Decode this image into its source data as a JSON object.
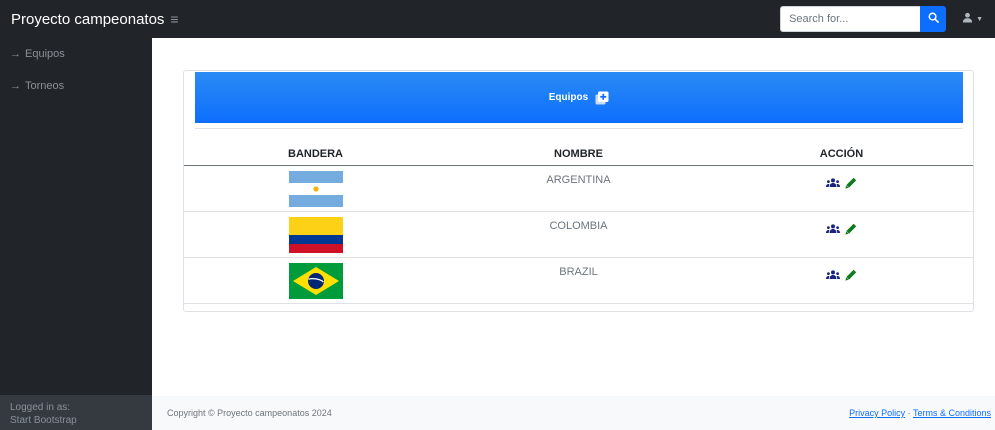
{
  "header": {
    "brand": "Proyecto campeonatos",
    "toggle_icon": "menu-icon",
    "search_placeholder": "Search for...",
    "search_icon": "search-icon",
    "user_icon": "user-icon"
  },
  "sidebar": {
    "items": [
      {
        "label": "Equipos",
        "icon": "arrow-right-icon"
      },
      {
        "label": "Torneos",
        "icon": "arrow-right-icon"
      }
    ],
    "footer": {
      "logged_in_label": "Logged in as:",
      "user": "Start Bootstrap"
    }
  },
  "main": {
    "banner_title": "Equipos",
    "banner_icon": "add-square-icon",
    "table": {
      "columns": [
        "BANDERA",
        "NOMBRE",
        "ACCIÓN"
      ],
      "rows": [
        {
          "flag": "argentina-flag",
          "name": "ARGENTINA",
          "actions": [
            "users-icon",
            "pencil-icon"
          ]
        },
        {
          "flag": "colombia-flag",
          "name": "COLOMBIA",
          "actions": [
            "users-icon",
            "pencil-icon"
          ]
        },
        {
          "flag": "brazil-flag",
          "name": "BRAZIL",
          "actions": [
            "users-icon",
            "pencil-icon"
          ]
        }
      ]
    }
  },
  "footer": {
    "copyright": "Copyright © Proyecto campeonatos 2024",
    "privacy": "Privacy Policy",
    "separator": "·",
    "terms": "Terms & Conditions"
  },
  "colors": {
    "dark": "#212529",
    "primary": "#0d6efd",
    "action_users": "#1a237e",
    "action_edit": "#0f7a1e"
  }
}
